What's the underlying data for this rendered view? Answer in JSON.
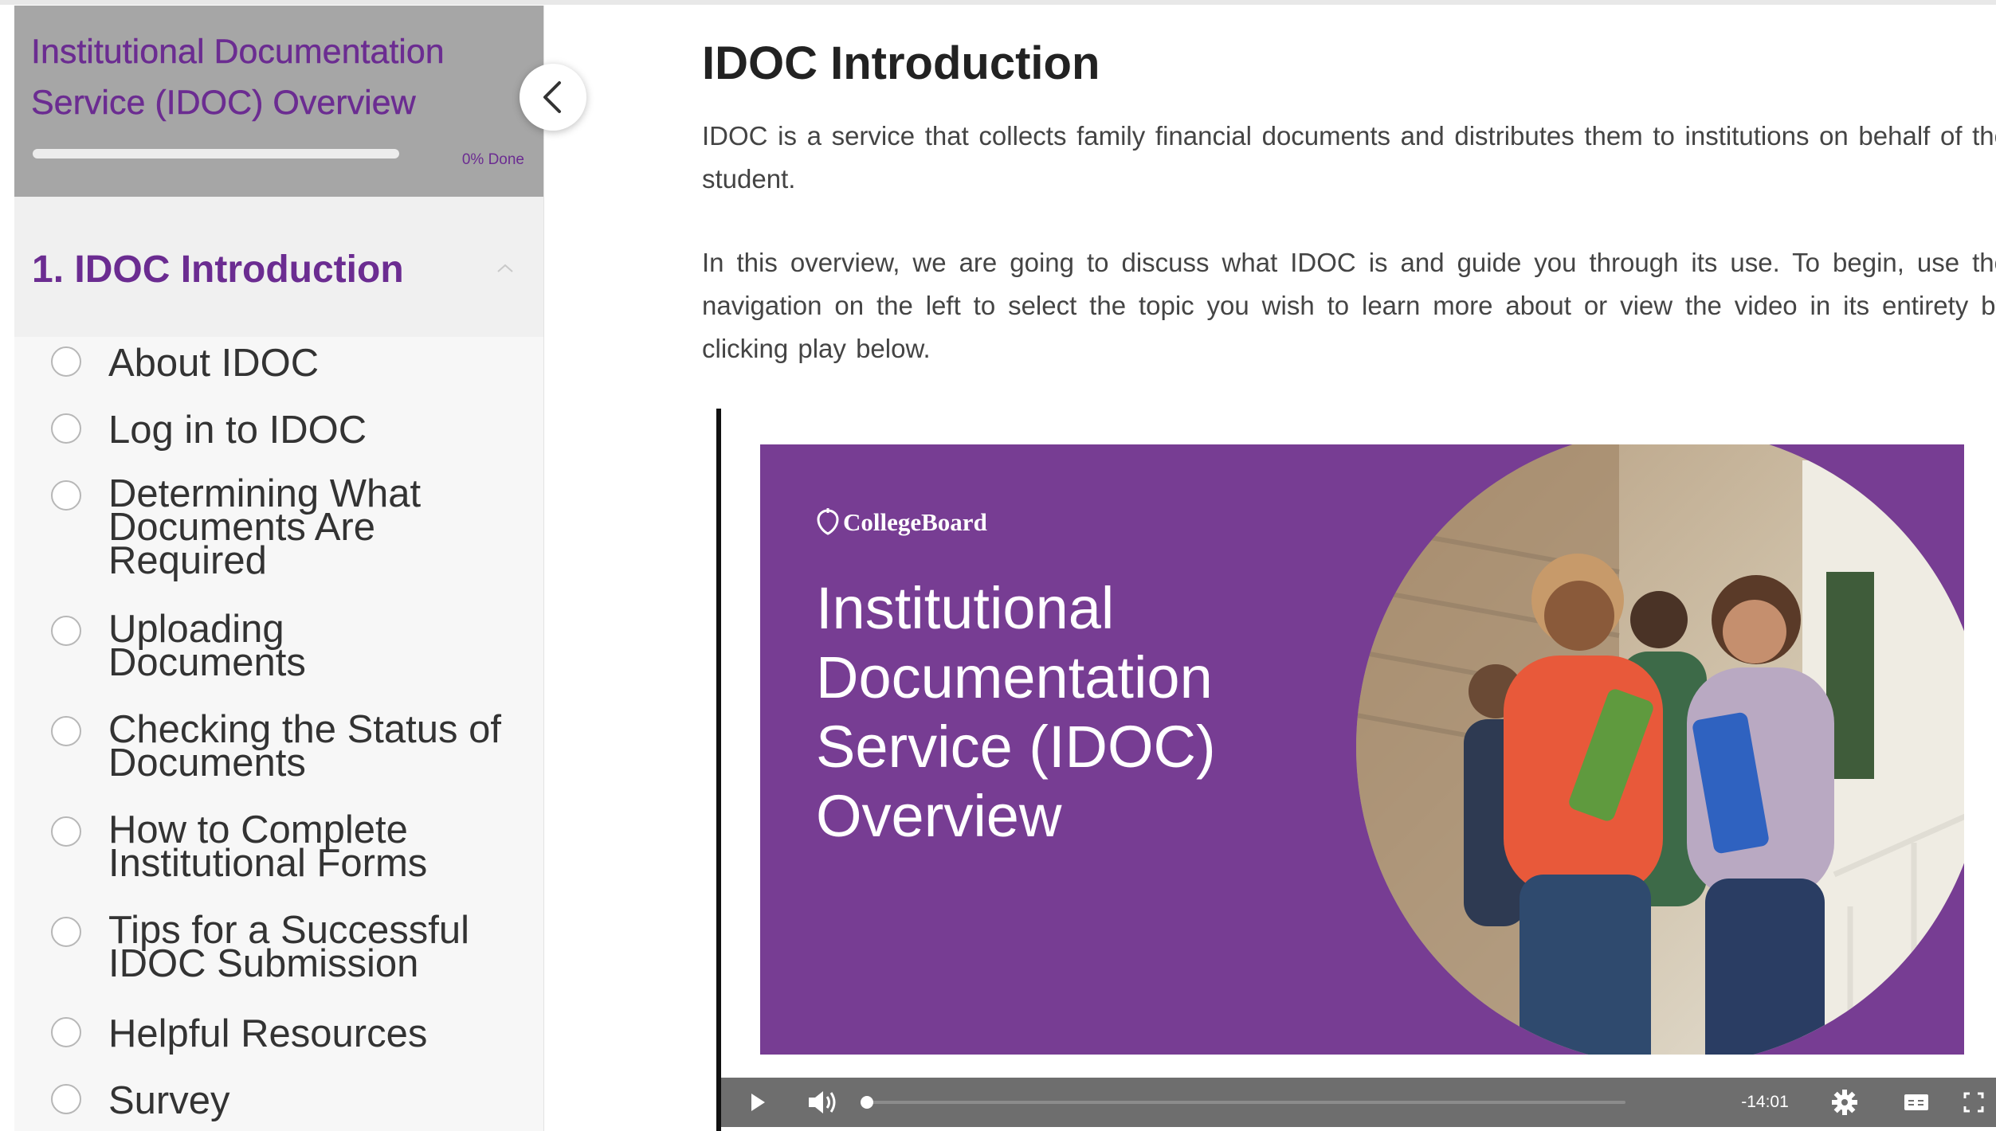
{
  "sidebar": {
    "course_title": "Institutional Documentation Service (IDOC) Overview",
    "progress_percent": 0,
    "progress_label": "0% Done",
    "section_title": "1. IDOC Introduction",
    "lessons": [
      {
        "label": "About IDOC"
      },
      {
        "label": "Log in to IDOC"
      },
      {
        "label": "Determining What Documents Are Required"
      },
      {
        "label": "Uploading Documents"
      },
      {
        "label": "Checking the Status of Documents"
      },
      {
        "label": "How to Complete Institutional Forms"
      },
      {
        "label": "Tips for a Successful IDOC Submission"
      },
      {
        "label": "Helpful Resources"
      },
      {
        "label": "Survey"
      }
    ]
  },
  "main": {
    "title": "IDOC Introduction",
    "paragraph1": "IDOC is a service that collects family financial documents and distributes them to institutions on behalf of the student.",
    "paragraph2": "In this overview, we are going to discuss what IDOC is and guide you through its use. To begin, use the navigation on the left to select the topic you wish to learn more about or view the video in its entirety by clicking play below."
  },
  "video": {
    "logo_text": "CollegeBoard",
    "slide_title": "Institutional Documentation Service (IDOC) Overview",
    "time_remaining": "-14:01",
    "played_fraction": 0
  },
  "colors": {
    "brand_purple": "#6b2c91",
    "slide_purple": "#773d93",
    "sidebar_header": "#a6a6a6",
    "controls_bar": "#6e6e6e"
  }
}
